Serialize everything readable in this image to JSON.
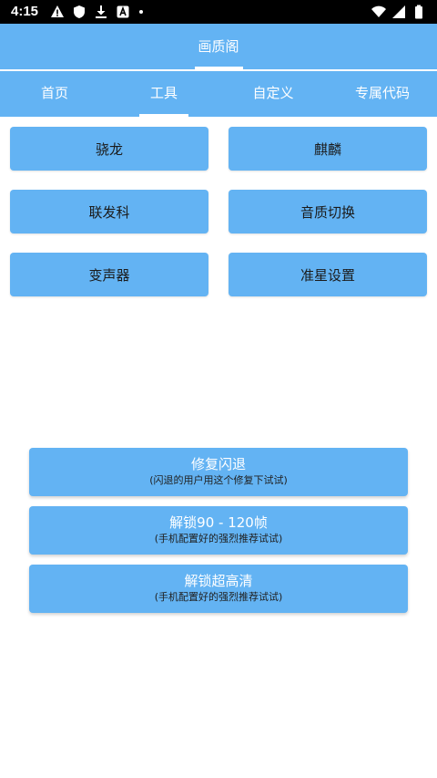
{
  "status_bar": {
    "time": "4:15",
    "left_icons": [
      "warning-icon",
      "shield-icon",
      "download-icon",
      "font-icon",
      "dot-icon"
    ],
    "right_icons": [
      "wifi-icon",
      "signal-icon",
      "battery-icon"
    ]
  },
  "app_bar": {
    "title": "画质阁"
  },
  "tabs": [
    {
      "label": "首页"
    },
    {
      "label": "工具"
    },
    {
      "label": "自定义"
    },
    {
      "label": "专属代码"
    }
  ],
  "active_tab": "工具",
  "tools": [
    {
      "label": "骁龙"
    },
    {
      "label": "麒麟"
    },
    {
      "label": "联发科"
    },
    {
      "label": "音质切换"
    },
    {
      "label": "变声器"
    },
    {
      "label": "准星设置"
    }
  ],
  "actions": [
    {
      "title": "修复闪退",
      "subtitle": "(闪退的用户用这个修复下试试)"
    },
    {
      "title": "解锁90 - 120帧",
      "subtitle": "(手机配置好的强烈推荐试试)"
    },
    {
      "title": "解锁超高清",
      "subtitle": "(手机配置好的强烈推荐试试)"
    }
  ],
  "colors": {
    "accent": "#63b3f3",
    "status_bar": "#000000",
    "text_on_accent": "#ffffff"
  }
}
